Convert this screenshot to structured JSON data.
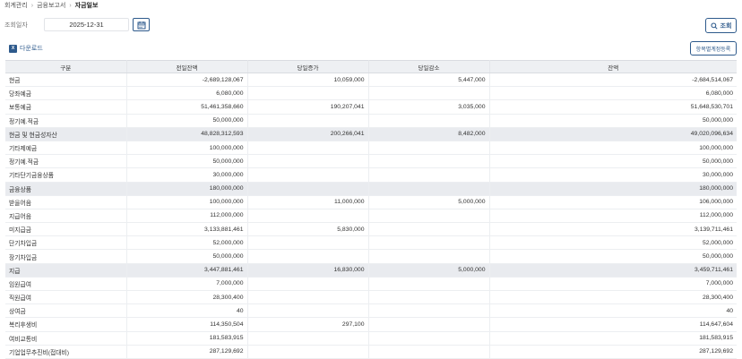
{
  "breadcrumb": [
    "회계관리",
    "금융보고서",
    "자금일보"
  ],
  "filter": {
    "label": "조회일자",
    "date": "2025-12-31"
  },
  "buttons": {
    "search": "조회",
    "download": "다운로드",
    "account_settings": "항목별계정등록"
  },
  "icons": {
    "calendar": "calendar-icon",
    "search": "search-icon",
    "excel": "excel-icon",
    "chevron": "chevron-right-icon"
  },
  "colors": {
    "accent": "#2e5a8c",
    "header_bg": "#eef0f3",
    "subtotal_bg": "#e9ebef"
  },
  "table": {
    "headers": [
      "구분",
      "전일잔액",
      "당일증가",
      "당일감소",
      "잔액"
    ],
    "rows": [
      {
        "label": "현금",
        "prev": "-2,689,128,067",
        "inc": "10,059,000",
        "dec": "5,447,000",
        "bal": "-2,684,514,067",
        "subtotal": false
      },
      {
        "label": "당좌예금",
        "prev": "6,080,000",
        "inc": "",
        "dec": "",
        "bal": "6,080,000",
        "subtotal": false
      },
      {
        "label": "보통예금",
        "prev": "51,461,358,660",
        "inc": "190,207,041",
        "dec": "3,035,000",
        "bal": "51,648,530,701",
        "subtotal": false
      },
      {
        "label": "정기예.적금",
        "prev": "50,000,000",
        "inc": "",
        "dec": "",
        "bal": "50,000,000",
        "subtotal": false
      },
      {
        "label": "현금 및 현금성자산",
        "prev": "48,828,312,593",
        "inc": "200,266,041",
        "dec": "8,482,000",
        "bal": "49,020,096,634",
        "subtotal": true
      },
      {
        "label": "기타제예금",
        "prev": "100,000,000",
        "inc": "",
        "dec": "",
        "bal": "100,000,000",
        "subtotal": false
      },
      {
        "label": "정기예.적금",
        "prev": "50,000,000",
        "inc": "",
        "dec": "",
        "bal": "50,000,000",
        "subtotal": false
      },
      {
        "label": "기타단기금융상품",
        "prev": "30,000,000",
        "inc": "",
        "dec": "",
        "bal": "30,000,000",
        "subtotal": false
      },
      {
        "label": "금융상품",
        "prev": "180,000,000",
        "inc": "",
        "dec": "",
        "bal": "180,000,000",
        "subtotal": true
      },
      {
        "label": "받을어음",
        "prev": "100,000,000",
        "inc": "11,000,000",
        "dec": "5,000,000",
        "bal": "106,000,000",
        "subtotal": false
      },
      {
        "label": "지급어음",
        "prev": "112,000,000",
        "inc": "",
        "dec": "",
        "bal": "112,000,000",
        "subtotal": false
      },
      {
        "label": "미지급금",
        "prev": "3,133,881,461",
        "inc": "5,830,000",
        "dec": "",
        "bal": "3,139,711,461",
        "subtotal": false
      },
      {
        "label": "단기차입금",
        "prev": "52,000,000",
        "inc": "",
        "dec": "",
        "bal": "52,000,000",
        "subtotal": false
      },
      {
        "label": "장기차입금",
        "prev": "50,000,000",
        "inc": "",
        "dec": "",
        "bal": "50,000,000",
        "subtotal": false
      },
      {
        "label": "지급",
        "prev": "3,447,881,461",
        "inc": "16,830,000",
        "dec": "5,000,000",
        "bal": "3,459,711,461",
        "subtotal": true
      },
      {
        "label": "임원급여",
        "prev": "7,000,000",
        "inc": "",
        "dec": "",
        "bal": "7,000,000",
        "subtotal": false
      },
      {
        "label": "직원급여",
        "prev": "28,300,400",
        "inc": "",
        "dec": "",
        "bal": "28,300,400",
        "subtotal": false
      },
      {
        "label": "상여금",
        "prev": "40",
        "inc": "",
        "dec": "",
        "bal": "40",
        "subtotal": false
      },
      {
        "label": "복리후생비",
        "prev": "114,350,504",
        "inc": "297,100",
        "dec": "",
        "bal": "114,647,604",
        "subtotal": false
      },
      {
        "label": "여비교통비",
        "prev": "181,583,915",
        "inc": "",
        "dec": "",
        "bal": "181,583,915",
        "subtotal": false
      },
      {
        "label": "기업업무추진비(접대비)",
        "prev": "287,129,692",
        "inc": "",
        "dec": "",
        "bal": "287,129,692",
        "subtotal": false
      }
    ]
  }
}
